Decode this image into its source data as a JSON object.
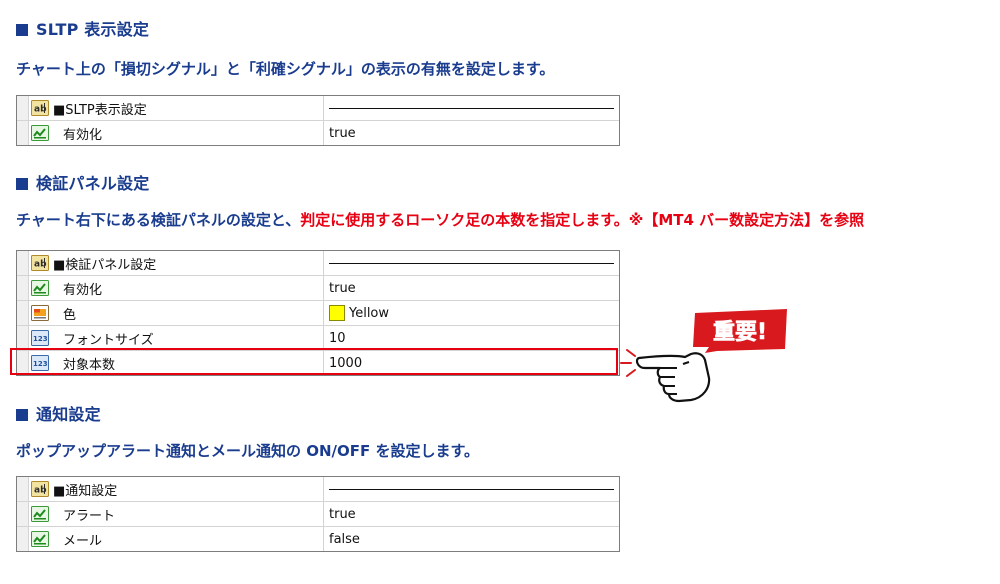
{
  "sections": [
    {
      "heading": "SLTP 表示設定",
      "description": "チャート上の「損切シグナル」と「利確シグナル」の表示の有無を設定します。",
      "table": {
        "header": "■SLTP表示設定",
        "rows": [
          {
            "label": "有効化",
            "value": "true"
          }
        ]
      }
    },
    {
      "heading": "検証パネル設定",
      "description_a": "チャート右下にある検証パネルの設定と、",
      "description_b": "判定に使用するローソク足の本数を指定します。※【MT4 バー数設定方法】を参照",
      "table": {
        "header": "■検証パネル設定",
        "rows": [
          {
            "label": "有効化",
            "value": "true"
          },
          {
            "label": "色",
            "value": "Yellow",
            "swatch": "#ffff00"
          },
          {
            "label": "フォントサイズ",
            "value": "10"
          },
          {
            "label": "対象本数",
            "value": "1000"
          }
        ]
      },
      "badge": "重要!"
    },
    {
      "heading": "通知設定",
      "description": "ポップアップアラート通知とメール通知の ON/OFF を設定します。",
      "table": {
        "header": "■通知設定",
        "rows": [
          {
            "label": "アラート",
            "value": "true"
          },
          {
            "label": "メール",
            "value": "false"
          }
        ]
      }
    }
  ],
  "colors": {
    "heading": "#1a3c8e",
    "accent_red": "#e60012"
  },
  "icons": [
    "ab-string-icon",
    "bool-toggle-icon",
    "color-icon",
    "number-123-icon",
    "pointing-hand-icon"
  ]
}
